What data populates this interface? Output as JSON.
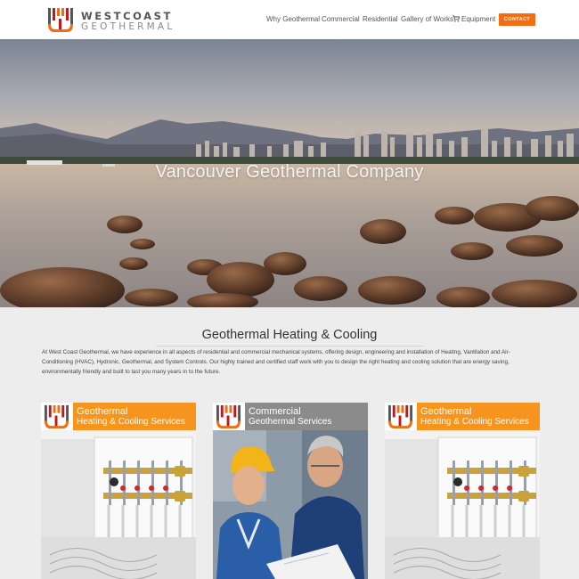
{
  "brand": {
    "word1": "WESTCOAST",
    "word2": "GEOTHERMAL",
    "colors": {
      "orange": "#f26c12",
      "red": "#c4161c",
      "gray": "#555555"
    }
  },
  "nav": {
    "items": [
      {
        "label": "Why Geothermal"
      },
      {
        "label": "Commercial"
      },
      {
        "label": "Residential"
      },
      {
        "label": "Gallery of Works"
      },
      {
        "label": "Equipment",
        "icon": "cart-icon"
      }
    ],
    "contact_label": "CONTACT"
  },
  "hero": {
    "title": "Vancouver Geothermal Company"
  },
  "intro": {
    "title": "Geothermal Heating & Cooling",
    "body": "At West Coast Geothermal, we have experience in all aspects of residential and commercial mechanical systems, offering design, engineering and installation of Heating, Vantilation and Air-Conditioning (HVAC), Hydronic, Geothermal, and System Controls. Our highly trained and certified staff work with you to design the right heating and cooling solution that are energy saving, environmentally friendly and built to last you many years in to the future."
  },
  "cards": [
    {
      "line1": "Geothermal",
      "line2": "Heating & Cooling Services",
      "header_color": "#f7941d",
      "image": "manifold-photo"
    },
    {
      "line1": "Commercial",
      "line2": "Geothermal Services",
      "header_color": "#8b8b8b",
      "image": "engineers-photo"
    },
    {
      "line1": "Geothermal",
      "line2": "Heating & Cooling Services",
      "header_color": "#f7941d",
      "image": "manifold-photo"
    }
  ]
}
